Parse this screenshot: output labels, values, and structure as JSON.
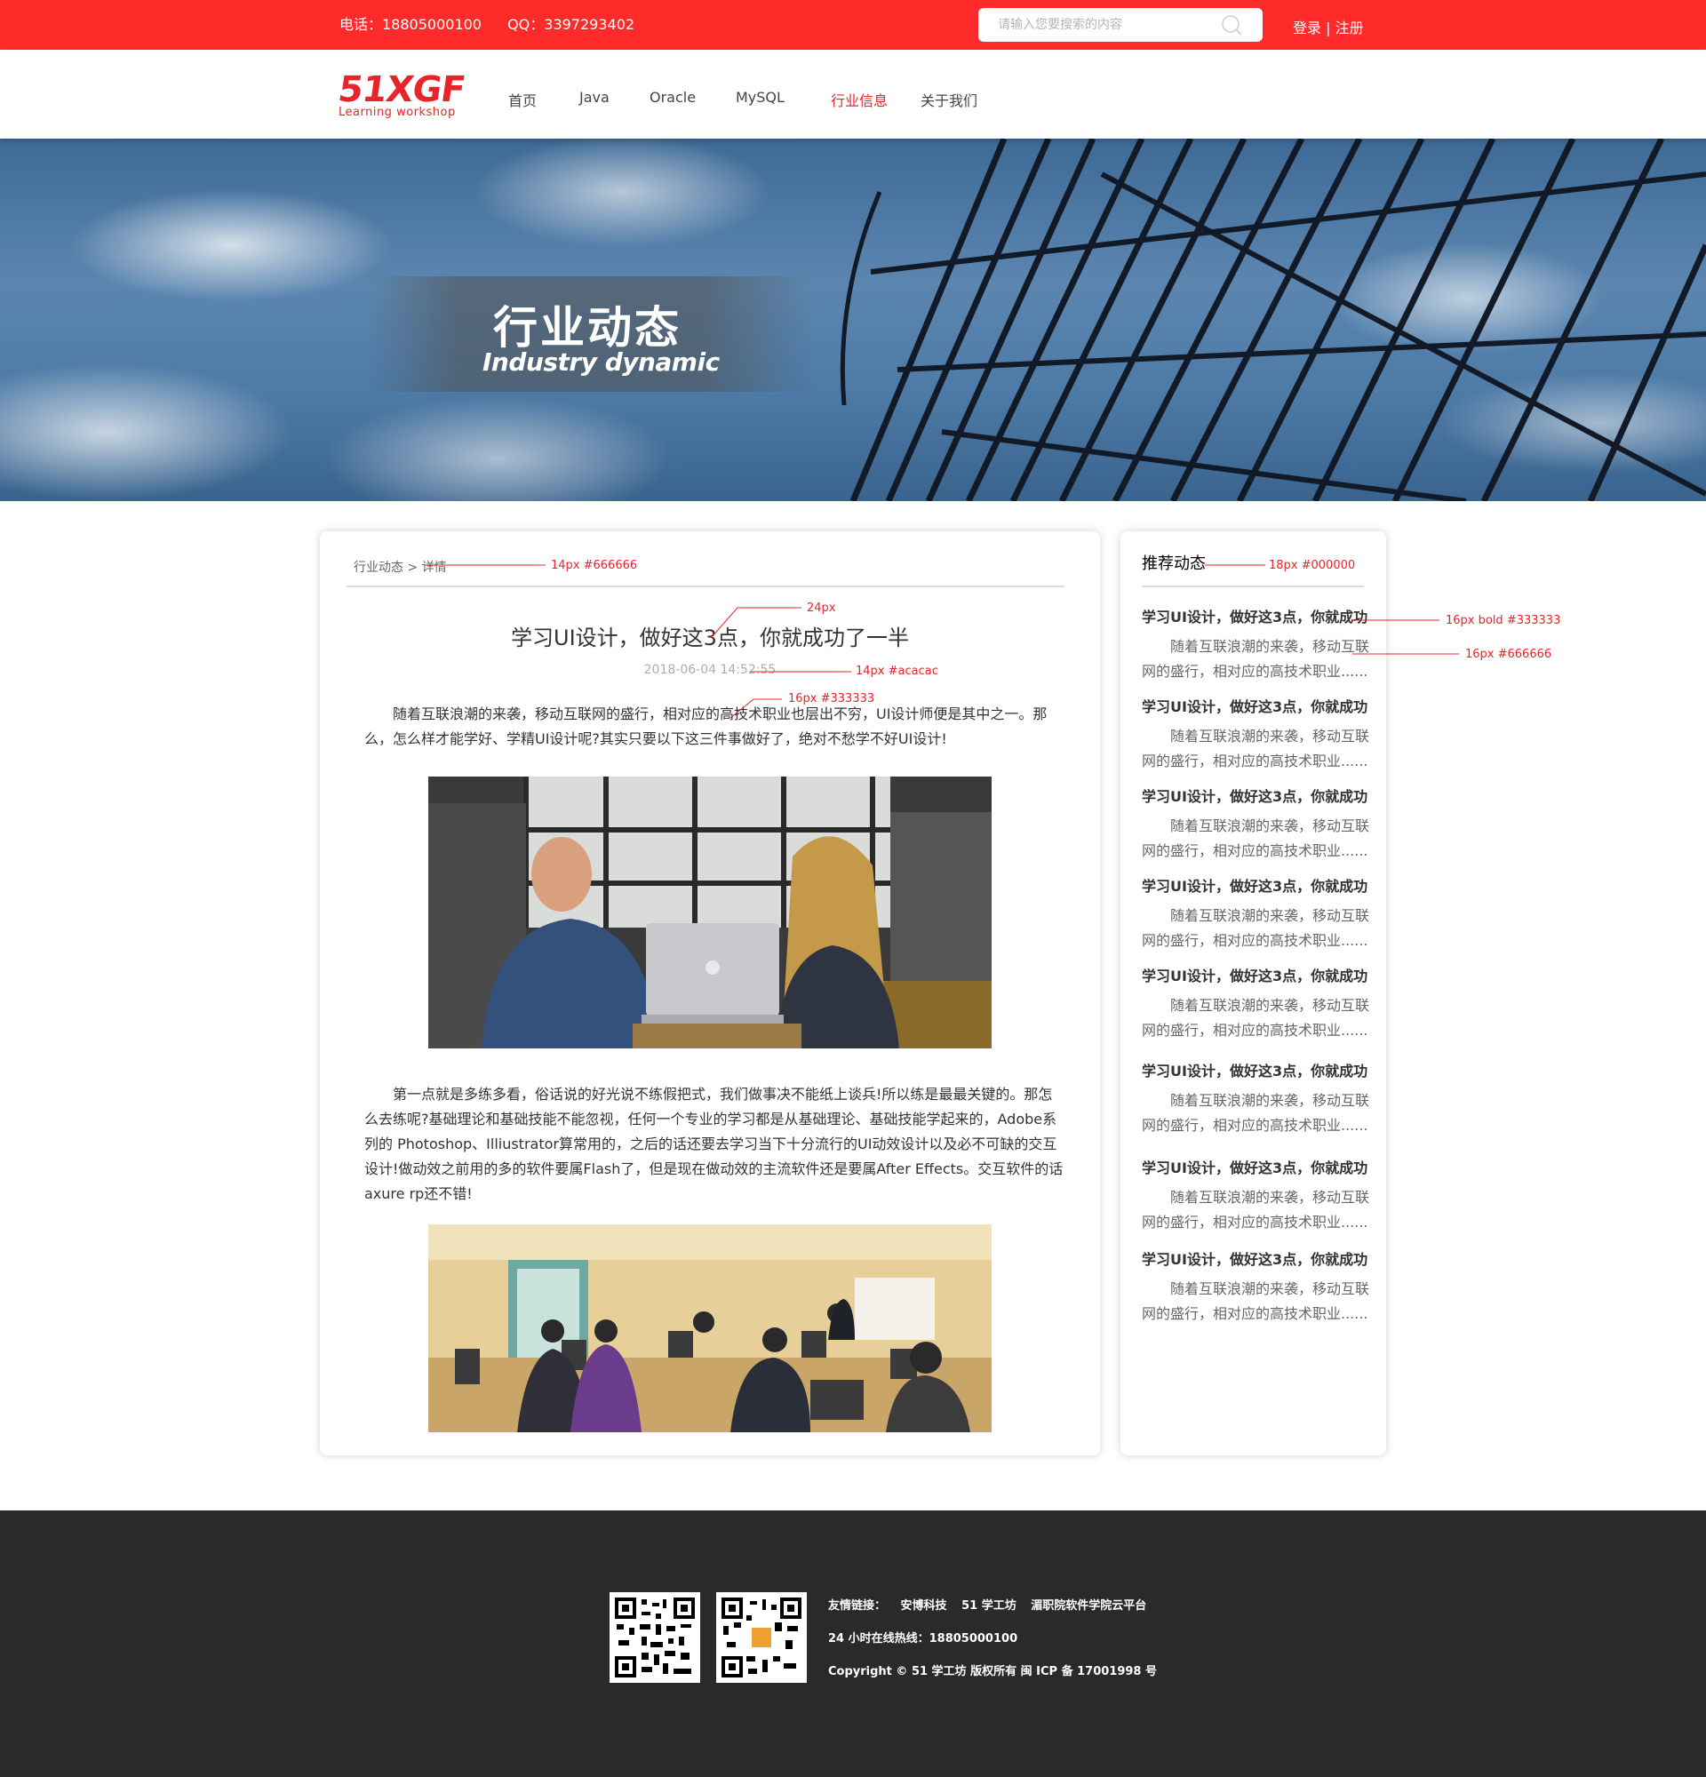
{
  "topbar": {
    "phone": "电话：18805000100",
    "qq": "QQ：3397293402",
    "search_placeholder": "请输入您要搜索的内容",
    "login": "登录",
    "separator": "|",
    "register": "注册",
    "bg_color": "#ff2a2a"
  },
  "logo": {
    "main": "51XGF",
    "sub": "Learning workshop",
    "color": "#e8232a"
  },
  "nav": {
    "items": [
      {
        "label": "首页"
      },
      {
        "label": "Java"
      },
      {
        "label": "Oracle"
      },
      {
        "label": "MySQL"
      },
      {
        "label": "行业信息",
        "active": true
      },
      {
        "label": "关于我们"
      }
    ]
  },
  "banner": {
    "title_cn": "行业动态",
    "title_en": "Industry dynamic"
  },
  "article": {
    "breadcrumb": "行业动态 > 详情",
    "title": "学习UI设计，做好这3点，你就成功了一半",
    "date": "2018-06-04 14:52:55",
    "paragraph1": "随着互联浪潮的来袭，移动互联网的盛行，相对应的高技术职业也层出不穷，UI设计师便是其中之一。那么，怎么样才能学好、学精UI设计呢?其实只要以下这三件事做好了，绝对不愁学不好UI设计!",
    "paragraph2": "第一点就是多练多看，俗话说的好光说不练假把式，我们做事决不能纸上谈兵!所以练是最最关键的。那怎么去练呢?基础理论和基础技能不能忽视，任何一个专业的学习都是从基础理论、基础技能学起来的，Adobe系列的 Photoshop、Illiustrator算常用的，之后的话还要去学习当下十分流行的UI动效设计以及必不可缺的交互设计!做动效之前用的多的软件要属Flash了，但是现在做动效的主流软件还是要属After Effects。交互软件的话axure rp还不错!"
  },
  "sidebar": {
    "title": "推荐动态",
    "items": [
      {
        "title": "学习UI设计，做好这3点，你就成功",
        "desc": "随着互联浪潮的来袭，移动互联网的盛行，相对应的高技术职业......"
      },
      {
        "title": "学习UI设计，做好这3点，你就成功",
        "desc": "随着互联浪潮的来袭，移动互联网的盛行，相对应的高技术职业......"
      },
      {
        "title": "学习UI设计，做好这3点，你就成功",
        "desc": "随着互联浪潮的来袭，移动互联网的盛行，相对应的高技术职业......"
      },
      {
        "title": "学习UI设计，做好这3点，你就成功",
        "desc": "随着互联浪潮的来袭，移动互联网的盛行，相对应的高技术职业......"
      },
      {
        "title": "学习UI设计，做好这3点，你就成功",
        "desc": "随着互联浪潮的来袭，移动互联网的盛行，相对应的高技术职业......"
      },
      {
        "title": "学习UI设计，做好这3点，你就成功",
        "desc": "随着互联浪潮的来袭，移动互联网的盛行，相对应的高技术职业......"
      },
      {
        "title": "学习UI设计，做好这3点，你就成功",
        "desc": "随着互联浪潮的来袭，移动互联网的盛行，相对应的高技术职业......"
      },
      {
        "title": "学习UI设计，做好这3点，你就成功",
        "desc": "随着互联浪潮的来袭，移动互联网的盛行，相对应的高技术职业......"
      }
    ]
  },
  "annotations": {
    "breadcrumb": "14px  #666666",
    "title": "24px",
    "date": "14px #acacac",
    "body": "16px #333333",
    "sidebar_title": "18px #000000",
    "rec_title": "16px bold #333333",
    "rec_desc": "16px #666666",
    "color": "#e8232a"
  },
  "footer": {
    "links_label": "友情链接：",
    "links": [
      "安博科技",
      "51 学工坊",
      "湄职院软件学院云平台"
    ],
    "hotline": "24 小时在线热线：18805000100",
    "copyright": "Copyright © 51 学工坊 版权所有 闽 ICP 备 17001998 号",
    "bg_color": "#2a2a2a"
  }
}
